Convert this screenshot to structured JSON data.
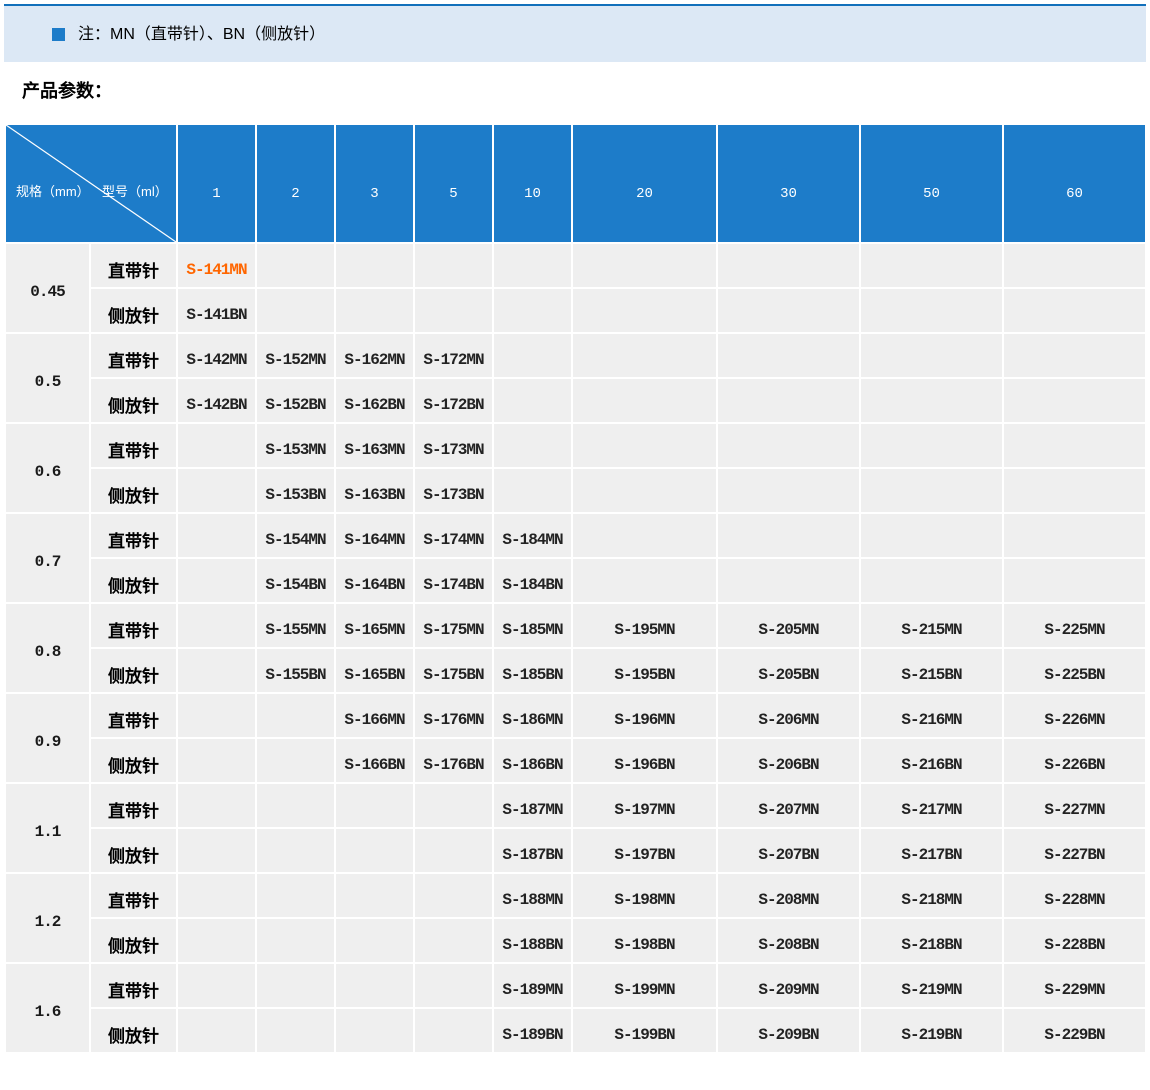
{
  "note_banner": {
    "icon": "blue-square-bullet",
    "text": "注：MN（直带针）、BN（侧放针）"
  },
  "section_title": "产品参数：",
  "table": {
    "corner": {
      "row_label": "规格（mm）",
      "col_label": "型号（ml）"
    },
    "volume_columns": [
      "1",
      "2",
      "3",
      "5",
      "10",
      "20",
      "30",
      "50",
      "60"
    ],
    "row_type_labels": [
      "直带针",
      "侧放针"
    ],
    "groups": [
      {
        "spec": "0.45",
        "mn": [
          "S-141MN",
          "",
          "",
          "",
          "",
          "",
          "",
          "",
          ""
        ],
        "bn": [
          "S-141BN",
          "",
          "",
          "",
          "",
          "",
          "",
          "",
          ""
        ]
      },
      {
        "spec": "0.5",
        "mn": [
          "S-142MN",
          "S-152MN",
          "S-162MN",
          "S-172MN",
          "",
          "",
          "",
          "",
          ""
        ],
        "bn": [
          "S-142BN",
          "S-152BN",
          "S-162BN",
          "S-172BN",
          "",
          "",
          "",
          "",
          ""
        ]
      },
      {
        "spec": "0.6",
        "mn": [
          "",
          "S-153MN",
          "S-163MN",
          "S-173MN",
          "",
          "",
          "",
          "",
          ""
        ],
        "bn": [
          "",
          "S-153BN",
          "S-163BN",
          "S-173BN",
          "",
          "",
          "",
          "",
          ""
        ]
      },
      {
        "spec": "0.7",
        "mn": [
          "",
          "S-154MN",
          "S-164MN",
          "S-174MN",
          "S-184MN",
          "",
          "",
          "",
          ""
        ],
        "bn": [
          "",
          "S-154BN",
          "S-164BN",
          "S-174BN",
          "S-184BN",
          "",
          "",
          "",
          ""
        ]
      },
      {
        "spec": "0.8",
        "mn": [
          "",
          "S-155MN",
          "S-165MN",
          "S-175MN",
          "S-185MN",
          "S-195MN",
          "S-205MN",
          "S-215MN",
          "S-225MN"
        ],
        "bn": [
          "",
          "S-155BN",
          "S-165BN",
          "S-175BN",
          "S-185BN",
          "S-195BN",
          "S-205BN",
          "S-215BN",
          "S-225BN"
        ]
      },
      {
        "spec": "0.9",
        "mn": [
          "",
          "",
          "S-166MN",
          "S-176MN",
          "S-186MN",
          "S-196MN",
          "S-206MN",
          "S-216MN",
          "S-226MN"
        ],
        "bn": [
          "",
          "",
          "S-166BN",
          "S-176BN",
          "S-186BN",
          "S-196BN",
          "S-206BN",
          "S-216BN",
          "S-226BN"
        ]
      },
      {
        "spec": "1.1",
        "mn": [
          "",
          "",
          "",
          "",
          "S-187MN",
          "S-197MN",
          "S-207MN",
          "S-217MN",
          "S-227MN"
        ],
        "bn": [
          "",
          "",
          "",
          "",
          "S-187BN",
          "S-197BN",
          "S-207BN",
          "S-217BN",
          "S-227BN"
        ]
      },
      {
        "spec": "1.2",
        "mn": [
          "",
          "",
          "",
          "",
          "S-188MN",
          "S-198MN",
          "S-208MN",
          "S-218MN",
          "S-228MN"
        ],
        "bn": [
          "",
          "",
          "",
          "",
          "S-188BN",
          "S-198BN",
          "S-208BN",
          "S-218BN",
          "S-228BN"
        ]
      },
      {
        "spec": "1.6",
        "mn": [
          "",
          "",
          "",
          "",
          "S-189MN",
          "S-199MN",
          "S-209MN",
          "S-219MN",
          "S-229MN"
        ],
        "bn": [
          "",
          "",
          "",
          "",
          "S-189BN",
          "S-199BN",
          "S-209BN",
          "S-219BN",
          "S-229BN"
        ]
      }
    ],
    "highlight": {
      "group_index": 0,
      "row": "mn",
      "col_index": 0,
      "color": "#ff6600"
    }
  },
  "colors": {
    "header_blue": "#1d7cc9",
    "banner_background": "#dce8f5",
    "banner_top_border": "#1170bb",
    "cell_background": "#efefef",
    "highlight_orange": "#ff6600",
    "body_text": "#222222"
  }
}
